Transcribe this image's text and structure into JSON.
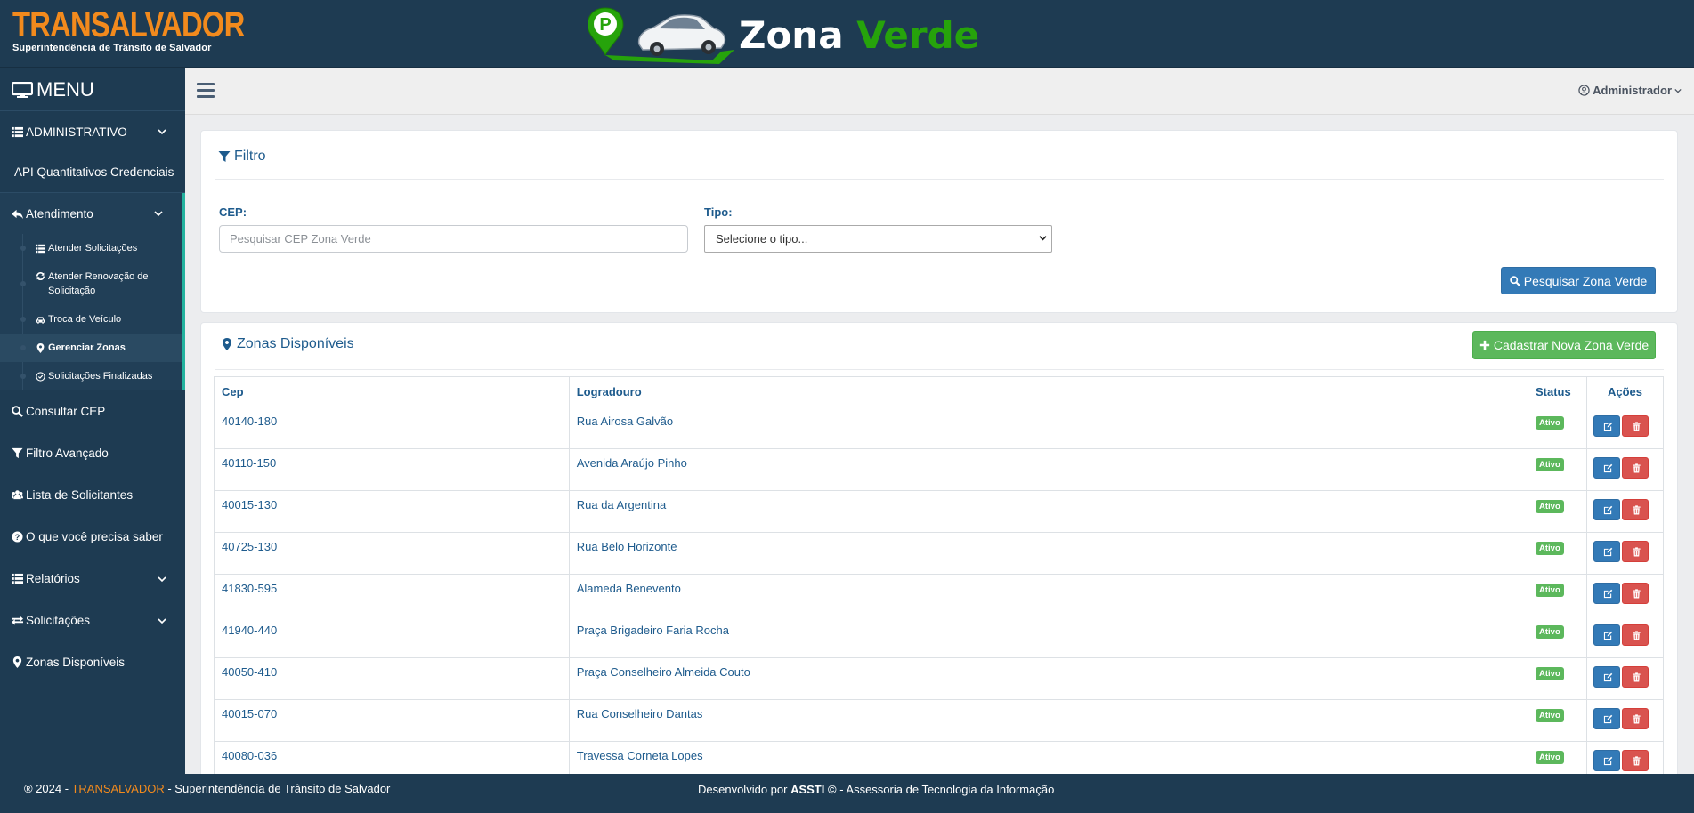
{
  "header": {
    "brand_name": "TRANSALVADOR",
    "brand_subtitle": "Superintendência de Trânsito de Salvador",
    "zv_word1": "Zona",
    "zv_word2": "Verde",
    "zv_badge": "P"
  },
  "sidebar": {
    "title": "MENU",
    "items": [
      {
        "label": "ADMINISTRATIVO",
        "icon": "list-icon"
      },
      {
        "label": "API Quantitativos Credenciais"
      },
      {
        "label": "Atendimento",
        "icon": "reply-icon"
      },
      {
        "label": "Consultar CEP",
        "icon": "search-icon"
      },
      {
        "label": "Filtro Avançado",
        "icon": "filter-icon"
      },
      {
        "label": "Lista de Solicitantes",
        "icon": "users-icon"
      },
      {
        "label": "O que você precisa saber",
        "icon": "question-circle-icon"
      },
      {
        "label": "Relatórios",
        "icon": "list-icon"
      },
      {
        "label": "Solicitações",
        "icon": "exchange-icon"
      },
      {
        "label": "Zonas Disponíveis",
        "icon": "map-marker-icon"
      }
    ],
    "subitems": [
      {
        "label": "Atender Solicitações",
        "icon": "list-icon"
      },
      {
        "label": "Atender Renovação de Solicitação",
        "icon": "refresh-icon"
      },
      {
        "label": "Troca de Veículo",
        "icon": "car-icon"
      },
      {
        "label": "Gerenciar Zonas",
        "icon": "map-marker-icon",
        "active": true
      },
      {
        "label": "Solicitações Finalizadas",
        "icon": "check-circle-icon"
      }
    ]
  },
  "toolbar": {
    "user_label": "Administrador"
  },
  "filter": {
    "title": "Filtro",
    "cep_label": "CEP:",
    "cep_placeholder": "Pesquisar CEP Zona Verde",
    "cep_value": "",
    "tipo_label": "Tipo:",
    "tipo_selected": "Selecione o tipo...",
    "search_button": "Pesquisar Zona Verde"
  },
  "zones": {
    "title": "Zonas Disponíveis",
    "new_button": "Cadastrar Nova Zona Verde",
    "columns": [
      "Cep",
      "Logradouro",
      "Status",
      "Ações"
    ],
    "rows": [
      {
        "cep": "40140-180",
        "logradouro": "Rua Airosa Galvão",
        "status": "Ativo"
      },
      {
        "cep": "40110-150",
        "logradouro": "Avenida Araújo Pinho",
        "status": "Ativo"
      },
      {
        "cep": "40015-130",
        "logradouro": "Rua da Argentina",
        "status": "Ativo"
      },
      {
        "cep": "40725-130",
        "logradouro": "Rua Belo Horizonte",
        "status": "Ativo"
      },
      {
        "cep": "41830-595",
        "logradouro": "Alameda Benevento",
        "status": "Ativo"
      },
      {
        "cep": "41940-440",
        "logradouro": "Praça Brigadeiro Faria Rocha",
        "status": "Ativo"
      },
      {
        "cep": "40050-410",
        "logradouro": "Praça Conselheiro Almeida Couto",
        "status": "Ativo"
      },
      {
        "cep": "40015-070",
        "logradouro": "Rua Conselheiro Dantas",
        "status": "Ativo"
      },
      {
        "cep": "40080-036",
        "logradouro": "Travessa Corneta Lopes",
        "status": "Ativo"
      }
    ]
  },
  "footer": {
    "copyright": "® 2024 -",
    "brand": "TRANSALVADOR",
    "org": "- Superintendência de Trânsito de Salvador",
    "dev_prefix": "Desenvolvido por",
    "dev_name": "ASSTI ©",
    "dev_suffix": "- Assessoria de Tecnologia da Informação"
  },
  "colors": {
    "header_bg": "#1e3b52",
    "brand_orange": "#f28a1d",
    "zone_green": "#26a30b",
    "primary_blue": "#337ab7",
    "success_green": "#5cb85c",
    "danger_red": "#d9534f",
    "sidebar_active_border": "#23b39f"
  }
}
